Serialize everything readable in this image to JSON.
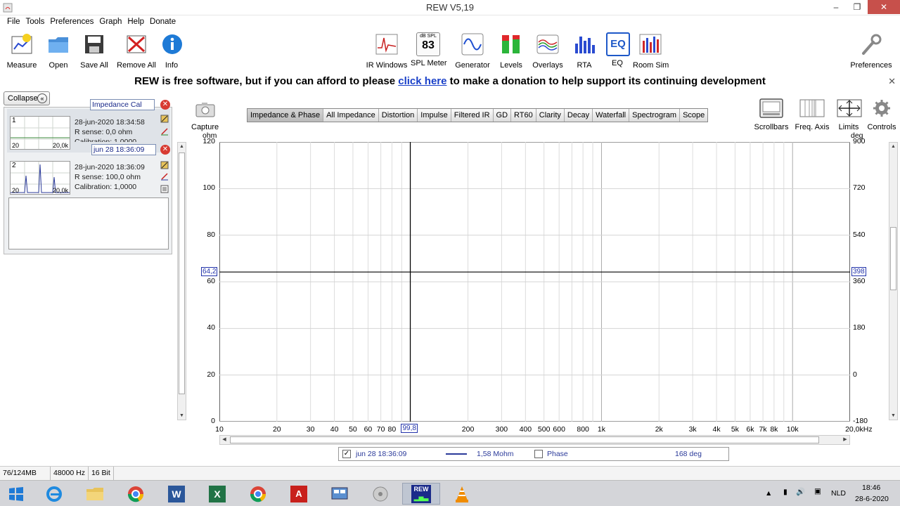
{
  "window": {
    "title": "REW V5,19"
  },
  "menu": [
    "File",
    "Tools",
    "Preferences",
    "Graph",
    "Help",
    "Donate"
  ],
  "toolbar_left": [
    {
      "label": "Measure",
      "icon": "measure-icon"
    },
    {
      "label": "Open",
      "icon": "folder-icon"
    },
    {
      "label": "Save All",
      "icon": "save-icon"
    },
    {
      "label": "Remove All",
      "icon": "remove-all-icon"
    },
    {
      "label": "Info",
      "icon": "info-icon"
    }
  ],
  "toolbar_center": [
    {
      "label": "IR Windows",
      "icon": "ir-windows-icon"
    },
    {
      "label": "SPL Meter",
      "icon": "spl-meter-icon",
      "readout_unit": "dB SPL",
      "readout": "83"
    },
    {
      "label": "Generator",
      "icon": "generator-icon"
    },
    {
      "label": "Levels",
      "icon": "levels-icon"
    },
    {
      "label": "Overlays",
      "icon": "overlays-icon"
    },
    {
      "label": "RTA",
      "icon": "rta-icon"
    },
    {
      "label": "EQ",
      "icon": "eq-icon"
    },
    {
      "label": "Room Sim",
      "icon": "room-sim-icon"
    }
  ],
  "toolbar_right": {
    "label": "Preferences",
    "icon": "wrench-icon"
  },
  "banner": {
    "before": "REW is free software, but if you can afford to please ",
    "link": "click here",
    "after": " to make a donation to help support its continuing development"
  },
  "left_panel": {
    "collapse_label": "Collapse",
    "measurements": [
      {
        "index": "1",
        "name": "Impedance Cal",
        "date": "28-jun-2020 18:34:58",
        "rsense": "R sense: 0,0 ohm",
        "calibration": "Calibration: 1,0000",
        "thumb_lo": "20",
        "thumb_hi": "20,0k"
      },
      {
        "index": "2",
        "name": "jun 28 18:36:09",
        "date": "28-jun-2020 18:36:09",
        "rsense": "R sense: 100,0 ohm",
        "calibration": "Calibration: 1,0000",
        "thumb_lo": "20",
        "thumb_hi": "20,0k"
      }
    ]
  },
  "graph_header": {
    "capture_label": "Capture",
    "tabs": [
      "Impedance & Phase",
      "All Impedance",
      "Distortion",
      "Impulse",
      "Filtered IR",
      "GD",
      "RT60",
      "Clarity",
      "Decay",
      "Waterfall",
      "Spectrogram",
      "Scope"
    ],
    "active_tab": 0,
    "right_tools": [
      "Scrollbars",
      "Freq. Axis",
      "Limits",
      "Controls"
    ]
  },
  "chart_data": {
    "type": "line",
    "title": "",
    "xlabel": "Hz",
    "ylabel": "ohm",
    "y2label": "deg",
    "xscale": "log",
    "xlim": [
      10,
      20000
    ],
    "ylim": [
      0,
      120
    ],
    "y2lim": [
      -180,
      900
    ],
    "x_ticks": [
      10,
      20,
      30,
      40,
      50,
      60,
      70,
      80,
      200,
      300,
      400,
      500,
      600,
      800,
      1000,
      2000,
      3000,
      4000,
      5000,
      6000,
      7000,
      8000,
      10000,
      20000
    ],
    "x_tick_labels": [
      "10",
      "20",
      "30",
      "40",
      "50",
      "60",
      "70",
      "80",
      "200",
      "300",
      "400",
      "500",
      "600",
      "800",
      "1k",
      "2k",
      "3k",
      "4k",
      "5k",
      "6k",
      "7k",
      "8k",
      "10k",
      "20,0kHz"
    ],
    "y_ticks": [
      0,
      20,
      40,
      60,
      80,
      100,
      120
    ],
    "y2_ticks": [
      -180,
      0,
      180,
      360,
      540,
      720,
      900
    ],
    "grid": true,
    "cursor": {
      "x": 99.8,
      "x_label": "99,8",
      "y_label": "64,2",
      "y2_label": "398",
      "y_value": 64.2
    },
    "series": []
  },
  "legend": {
    "series1_name": "jun 28 18:36:09",
    "series1_value": "1,58 Mohm",
    "series2_name": "Phase",
    "series2_value": "168 deg",
    "series1_color": "#2b3a9a"
  },
  "status": {
    "memory": "76/124MB",
    "rate": "48000 Hz",
    "bits": "16 Bit"
  },
  "taskbar": {
    "apps": [
      "windows-start-icon",
      "internet-explorer-icon",
      "file-explorer-icon",
      "chrome-icon",
      "word-icon",
      "excel-icon",
      "chrome-icon",
      "acrobat-icon",
      "control-panel-icon",
      "media-player-icon",
      "rew-icon",
      "vlc-icon"
    ],
    "language": "NLD",
    "time": "18:46",
    "date": "28-6-2020"
  }
}
